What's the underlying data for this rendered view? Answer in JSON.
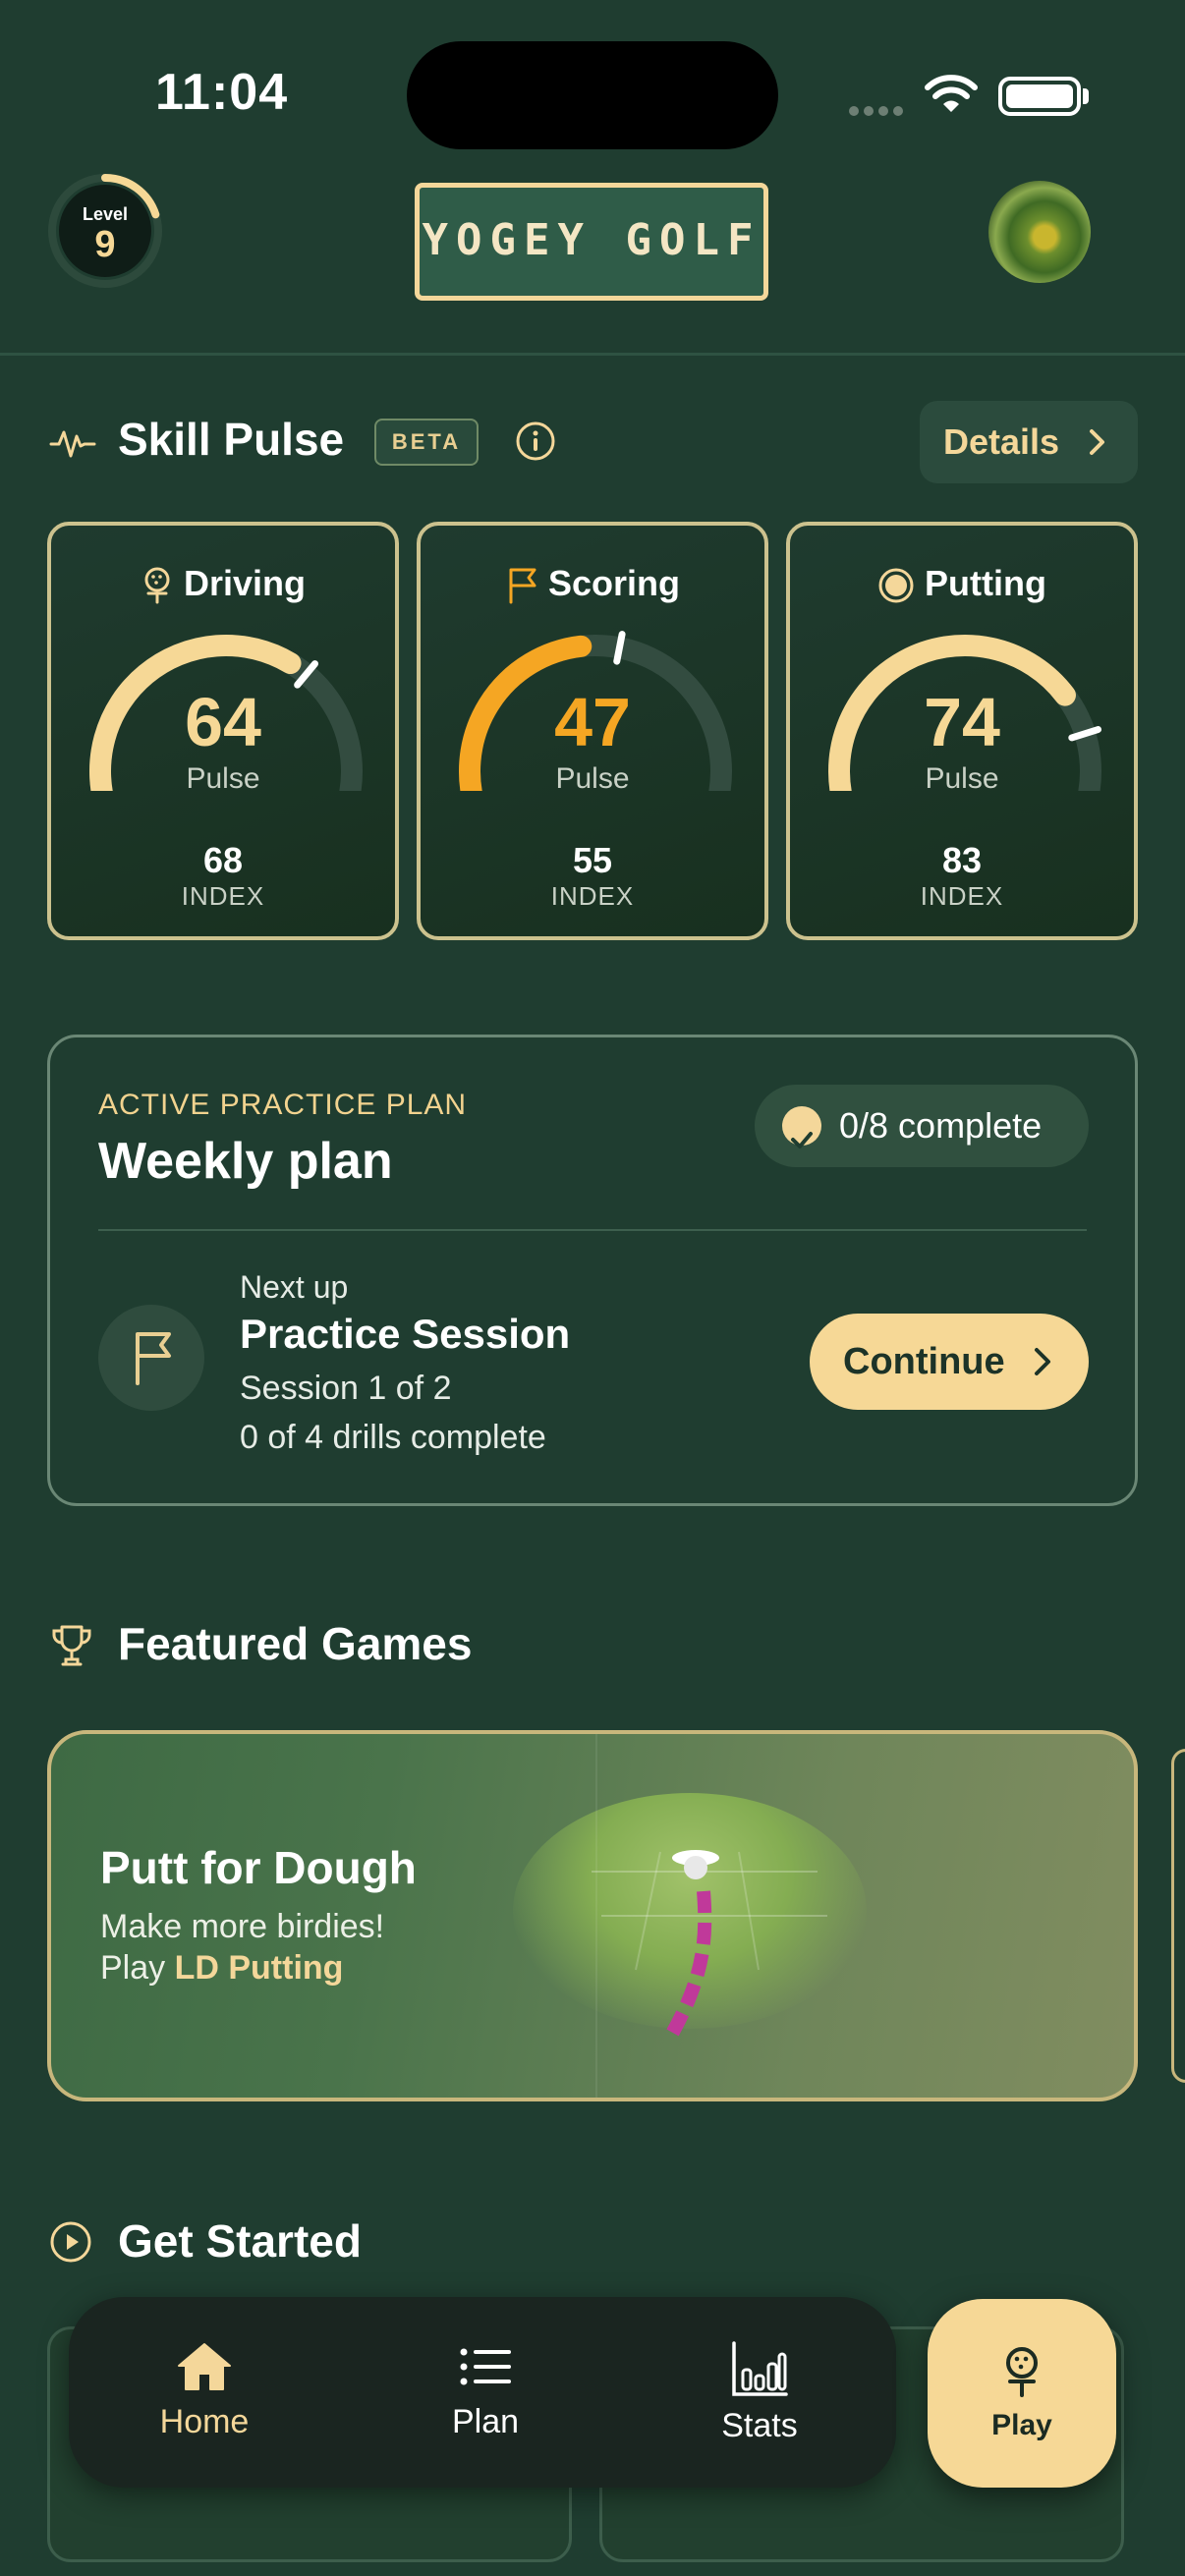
{
  "status_bar": {
    "time": "11:04"
  },
  "header": {
    "level_label": "Level",
    "level_value": "9",
    "level_progress": 0.2,
    "logo_text": "YOGEY GOLF"
  },
  "skill_pulse": {
    "title": "Skill Pulse",
    "badge": "BETA",
    "details_label": "Details",
    "cards": [
      {
        "name": "Driving",
        "icon": "golf-tee-icon",
        "pulse": "64",
        "pulse_label": "Pulse",
        "index": "68",
        "index_label": "INDEX",
        "color": "#f6d896"
      },
      {
        "name": "Scoring",
        "icon": "flag-icon",
        "pulse": "47",
        "pulse_label": "Pulse",
        "index": "55",
        "index_label": "INDEX",
        "color": "#f5a623"
      },
      {
        "name": "Putting",
        "icon": "hole-icon",
        "pulse": "74",
        "pulse_label": "Pulse",
        "index": "83",
        "index_label": "INDEX",
        "color": "#f6d896"
      }
    ]
  },
  "practice_plan": {
    "eyebrow": "ACTIVE PRACTICE PLAN",
    "title": "Weekly plan",
    "complete_label": "0/8 complete",
    "next_up_label": "Next up",
    "session_title": "Practice Session",
    "session_sub": "Session 1 of 2",
    "drills_sub": "0 of 4 drills complete",
    "continue_label": "Continue"
  },
  "featured_games": {
    "title": "Featured Games",
    "card": {
      "title": "Putt for Dough",
      "subtitle": "Make more birdies!",
      "play_prefix": "Play",
      "play_game": "LD Putting"
    }
  },
  "get_started": {
    "title": "Get Started"
  },
  "tabbar": {
    "tabs": [
      {
        "label": "Home",
        "icon": "home-icon",
        "active": true
      },
      {
        "label": "Plan",
        "icon": "list-icon",
        "active": false
      },
      {
        "label": "Stats",
        "icon": "bar-chart-icon",
        "active": false
      }
    ],
    "play_label": "Play"
  },
  "colors": {
    "background": "#1f3d30",
    "accent": "#f6d896",
    "scoring_accent": "#f5a623"
  }
}
